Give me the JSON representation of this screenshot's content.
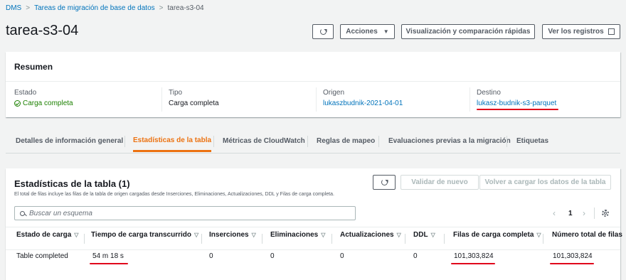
{
  "breadcrumb": {
    "items": [
      "DMS",
      "Tareas de migración de base de datos",
      "tarea-s3-04"
    ]
  },
  "page": {
    "title": "tarea-s3-04"
  },
  "header_actions": {
    "actions_label": "Acciones",
    "quick_view_label": "Visualización y comparación rápidas",
    "logs_label": "Ver los registros"
  },
  "summary": {
    "heading": "Resumen",
    "status_label": "Estado",
    "status_value": "Carga completa",
    "type_label": "Tipo",
    "type_value": "Carga completa",
    "source_label": "Origen",
    "source_value": "lukaszbudnik-2021-04-01",
    "target_label": "Destino",
    "target_value": "lukasz-budnik-s3-parquet"
  },
  "tabs": [
    "Detalles de información general",
    "Estadísticas de la tabla",
    "Métricas de CloudWatch",
    "Reglas de mapeo",
    "Evaluaciones previas a la migración",
    "Etiquetas"
  ],
  "table_stats": {
    "heading": "Estadísticas de la tabla (1)",
    "description": "El total de filas incluye las filas de la tabla de origen cargadas desde Inserciones, Eliminaciones, Actualizaciones, DDL y Filas de carga completa.",
    "validate_label": "Validar de nuevo",
    "reload_label": "Volver a cargar los datos de la tabla",
    "search_placeholder": "Buscar un esquema",
    "page_number": "1",
    "columns": [
      "Estado de carga",
      "Tiempo de carga transcurrido",
      "Inserciones",
      "Eliminaciones",
      "Actualizaciones",
      "DDL",
      "Filas de carga completa",
      "Número total de filas"
    ],
    "rows": [
      [
        "Table completed",
        "54 m 18 s",
        "0",
        "0",
        "0",
        "0",
        "101,303,824",
        "101,303,824"
      ]
    ]
  },
  "colors": {
    "accent": "#ec7211",
    "link": "#0073bb",
    "success": "#1d8102",
    "annotation": "#e0001b"
  }
}
